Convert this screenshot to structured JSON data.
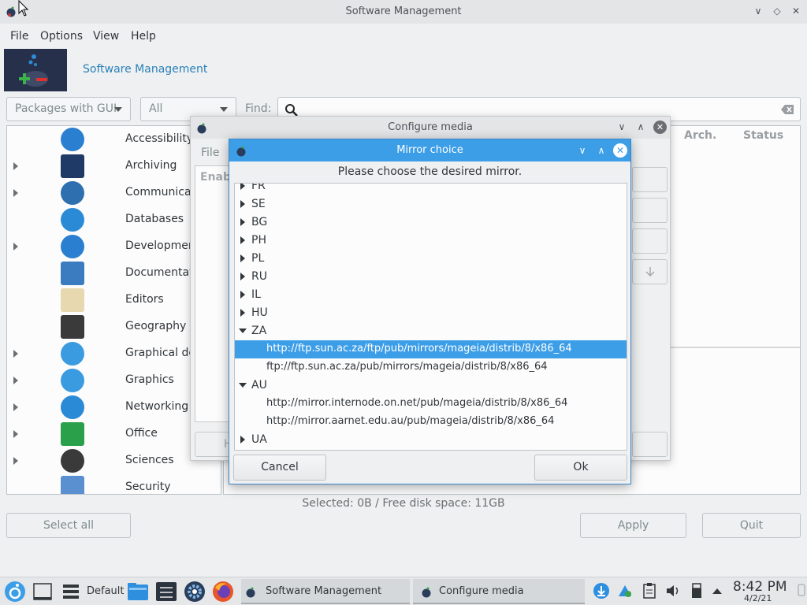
{
  "window": {
    "title": "Software Management"
  },
  "menubar": {
    "file": "File",
    "options": "Options",
    "view": "View",
    "help": "Help"
  },
  "banner": {
    "title": "Software Management"
  },
  "filters": {
    "package_type": "Packages with GUI",
    "scope": "All",
    "find_label": "Find:"
  },
  "categories": [
    {
      "label": "Accessibility",
      "expandable": false,
      "color": "#2a7fd0"
    },
    {
      "label": "Archiving",
      "expandable": true,
      "color": "#1f3a66"
    },
    {
      "label": "Communicat",
      "expandable": true,
      "color": "#2e6fb0"
    },
    {
      "label": "Databases",
      "expandable": false,
      "color": "#2a8ad6"
    },
    {
      "label": "Developmen",
      "expandable": true,
      "color": "#2a7fd0"
    },
    {
      "label": "Documentati",
      "expandable": false,
      "color": "#3b7bbf"
    },
    {
      "label": "Editors",
      "expandable": false,
      "color": "#e8d8b0"
    },
    {
      "label": "Geography",
      "expandable": false,
      "color": "#3a3a3a"
    },
    {
      "label": "Graphical de",
      "expandable": true,
      "color": "#3a9be0"
    },
    {
      "label": "Graphics",
      "expandable": true,
      "color": "#3a9be0"
    },
    {
      "label": "Networking",
      "expandable": true,
      "color": "#2a8ad6"
    },
    {
      "label": "Office",
      "expandable": true,
      "color": "#2aa04a"
    },
    {
      "label": "Sciences",
      "expandable": true,
      "color": "#3a3a3a"
    },
    {
      "label": "Security",
      "expandable": false,
      "color": "#5a8fd0"
    }
  ],
  "package_list": {
    "col_arch": "Arch.",
    "col_status": "Status"
  },
  "status": {
    "text": "Selected: 0B / Free disk space: 11GB"
  },
  "buttons": {
    "select_all": "Select all",
    "apply": "Apply",
    "quit": "Quit"
  },
  "configure_media": {
    "title": "Configure media",
    "menu_file": "File",
    "col_enabled": "Enab",
    "bottom_left": "H"
  },
  "mirror_choice": {
    "title": "Mirror choice",
    "prompt": "Please choose the desired mirror.",
    "rows": [
      {
        "type": "country",
        "label": "FR",
        "expanded": false
      },
      {
        "type": "country",
        "label": "SE",
        "expanded": false
      },
      {
        "type": "country",
        "label": "BG",
        "expanded": false
      },
      {
        "type": "country",
        "label": "PH",
        "expanded": false
      },
      {
        "type": "country",
        "label": "PL",
        "expanded": false
      },
      {
        "type": "country",
        "label": "RU",
        "expanded": false
      },
      {
        "type": "country",
        "label": "IL",
        "expanded": false
      },
      {
        "type": "country",
        "label": "HU",
        "expanded": false
      },
      {
        "type": "country",
        "label": "ZA",
        "expanded": true
      },
      {
        "type": "mirror",
        "label": "http://ftp.sun.ac.za/ftp/pub/mirrors/mageia/distrib/8/x86_64",
        "selected": true
      },
      {
        "type": "mirror",
        "label": "ftp://ftp.sun.ac.za/pub/mirrors/mageia/distrib/8/x86_64",
        "selected": false
      },
      {
        "type": "country",
        "label": "AU",
        "expanded": true
      },
      {
        "type": "mirror",
        "label": "http://mirror.internode.on.net/pub/mageia/distrib/8/x86_64",
        "selected": false
      },
      {
        "type": "mirror",
        "label": "http://mirror.aarnet.edu.au/pub/mageia/distrib/8/x86_64",
        "selected": false
      },
      {
        "type": "country",
        "label": "UA",
        "expanded": false
      }
    ],
    "cancel": "Cancel",
    "ok": "Ok"
  },
  "taskbar": {
    "activity": "Default",
    "tasks": [
      {
        "label": "Software Management"
      },
      {
        "label": "Configure media"
      }
    ],
    "time": "8:42 PM",
    "date": "4/2/21"
  },
  "colors": {
    "accent": "#3d9ee8",
    "link": "#2980b9",
    "banner_bg": "#26304a"
  }
}
